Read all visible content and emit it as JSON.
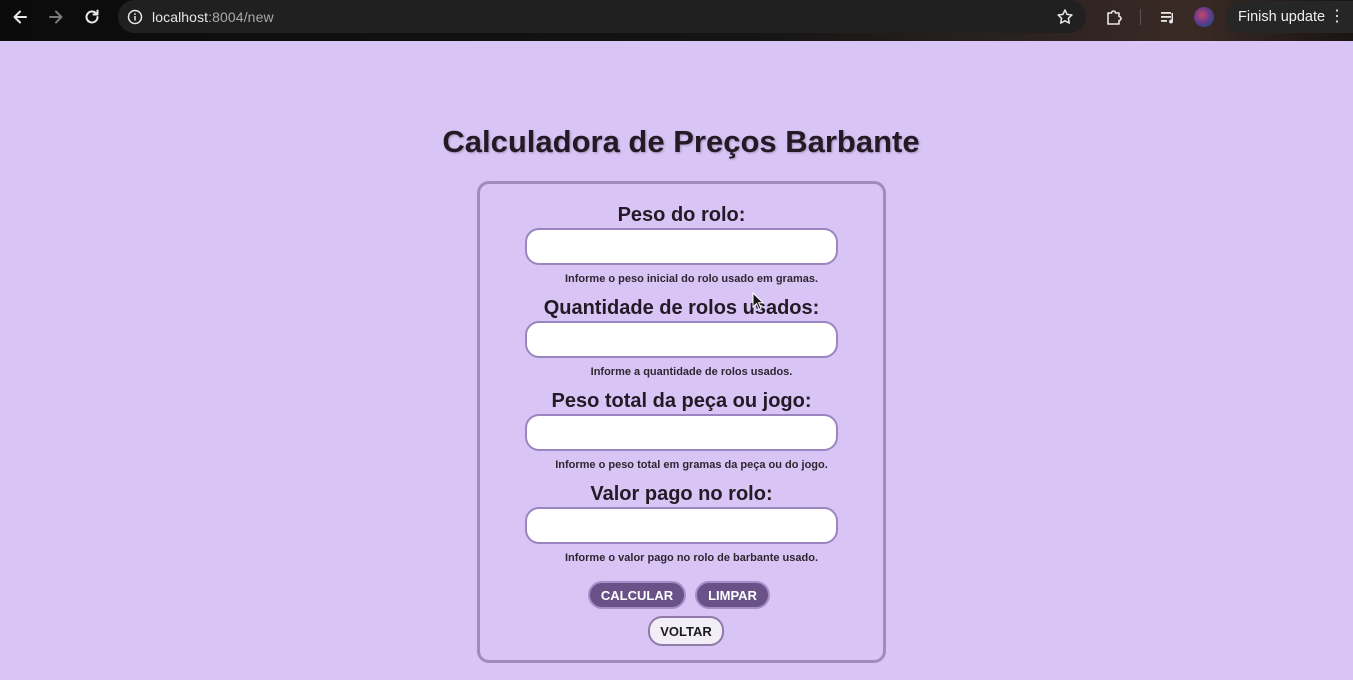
{
  "browser": {
    "url_host": "localhost",
    "url_path": ":8004/new",
    "update_label": "Finish update"
  },
  "page": {
    "title": "Calculadora de Preços Barbante"
  },
  "form": {
    "fields": [
      {
        "label": "Peso do rolo:",
        "value": "",
        "hint": "Informe o peso inicial do rolo usado em gramas."
      },
      {
        "label": "Quantidade de rolos usados:",
        "value": "",
        "hint": "Informe a quantidade de rolos usados."
      },
      {
        "label": "Peso total da peça ou jogo:",
        "value": "",
        "hint": "Informe o peso total em gramas da peça ou do jogo."
      },
      {
        "label": "Valor pago no rolo:",
        "value": "",
        "hint": "Informe o valor pago no rolo de barbante usado."
      }
    ],
    "calculate_label": "CALCULAR",
    "clear_label": "LIMPAR",
    "back_label": "VOLTAR"
  },
  "colors": {
    "background": "#d8c5f5",
    "primary_button": "#6a5289",
    "border": "#a08bbf"
  },
  "icons": [
    "back-arrow-icon",
    "forward-arrow-icon",
    "reload-icon",
    "site-info-icon",
    "bookmark-star-icon",
    "extensions-icon",
    "media-control-icon",
    "profile-avatar",
    "more-menu-icon"
  ]
}
